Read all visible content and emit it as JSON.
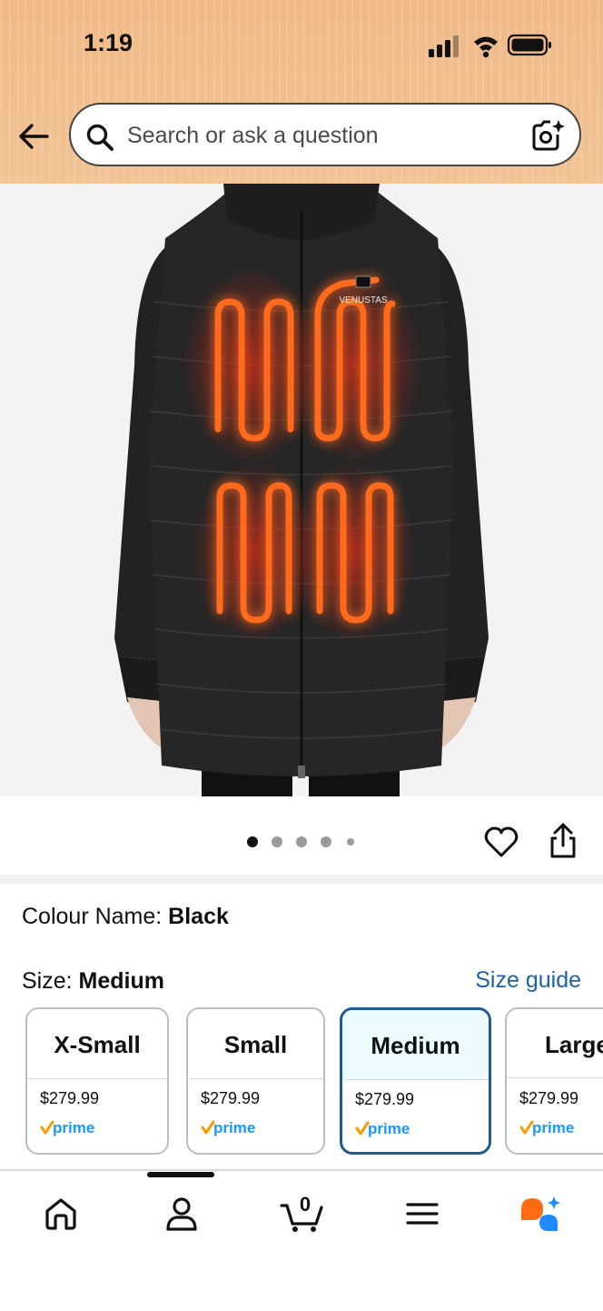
{
  "status_bar": {
    "time": "1:19"
  },
  "search": {
    "placeholder": "Search or ask a question"
  },
  "product_image": {
    "brand_logo_text": "VENUSTAS",
    "dots_total": 5,
    "active_dot": 1
  },
  "colour": {
    "label": "Colour Name: ",
    "value": "Black"
  },
  "size": {
    "label": "Size: ",
    "value": "Medium",
    "guide": "Size guide"
  },
  "sizes": [
    {
      "name": "X-Small",
      "price": "$279.99",
      "prime": "prime"
    },
    {
      "name": "Small",
      "price": "$279.99",
      "prime": "prime"
    },
    {
      "name": "Medium",
      "price": "$279.99",
      "prime": "prime",
      "selected": true
    },
    {
      "name": "Large",
      "price": "$279.99",
      "prime": "prime"
    }
  ],
  "bottom_nav": {
    "cart_count": "0"
  },
  "colors": {
    "header": "#efb987",
    "link": "#2162a1",
    "heat": "#ff5a1a",
    "prime_check": "#ff9900",
    "prime_text": "#1a98ff",
    "rufus_orange": "#ff6a13",
    "rufus_blue": "#1d8bff"
  }
}
